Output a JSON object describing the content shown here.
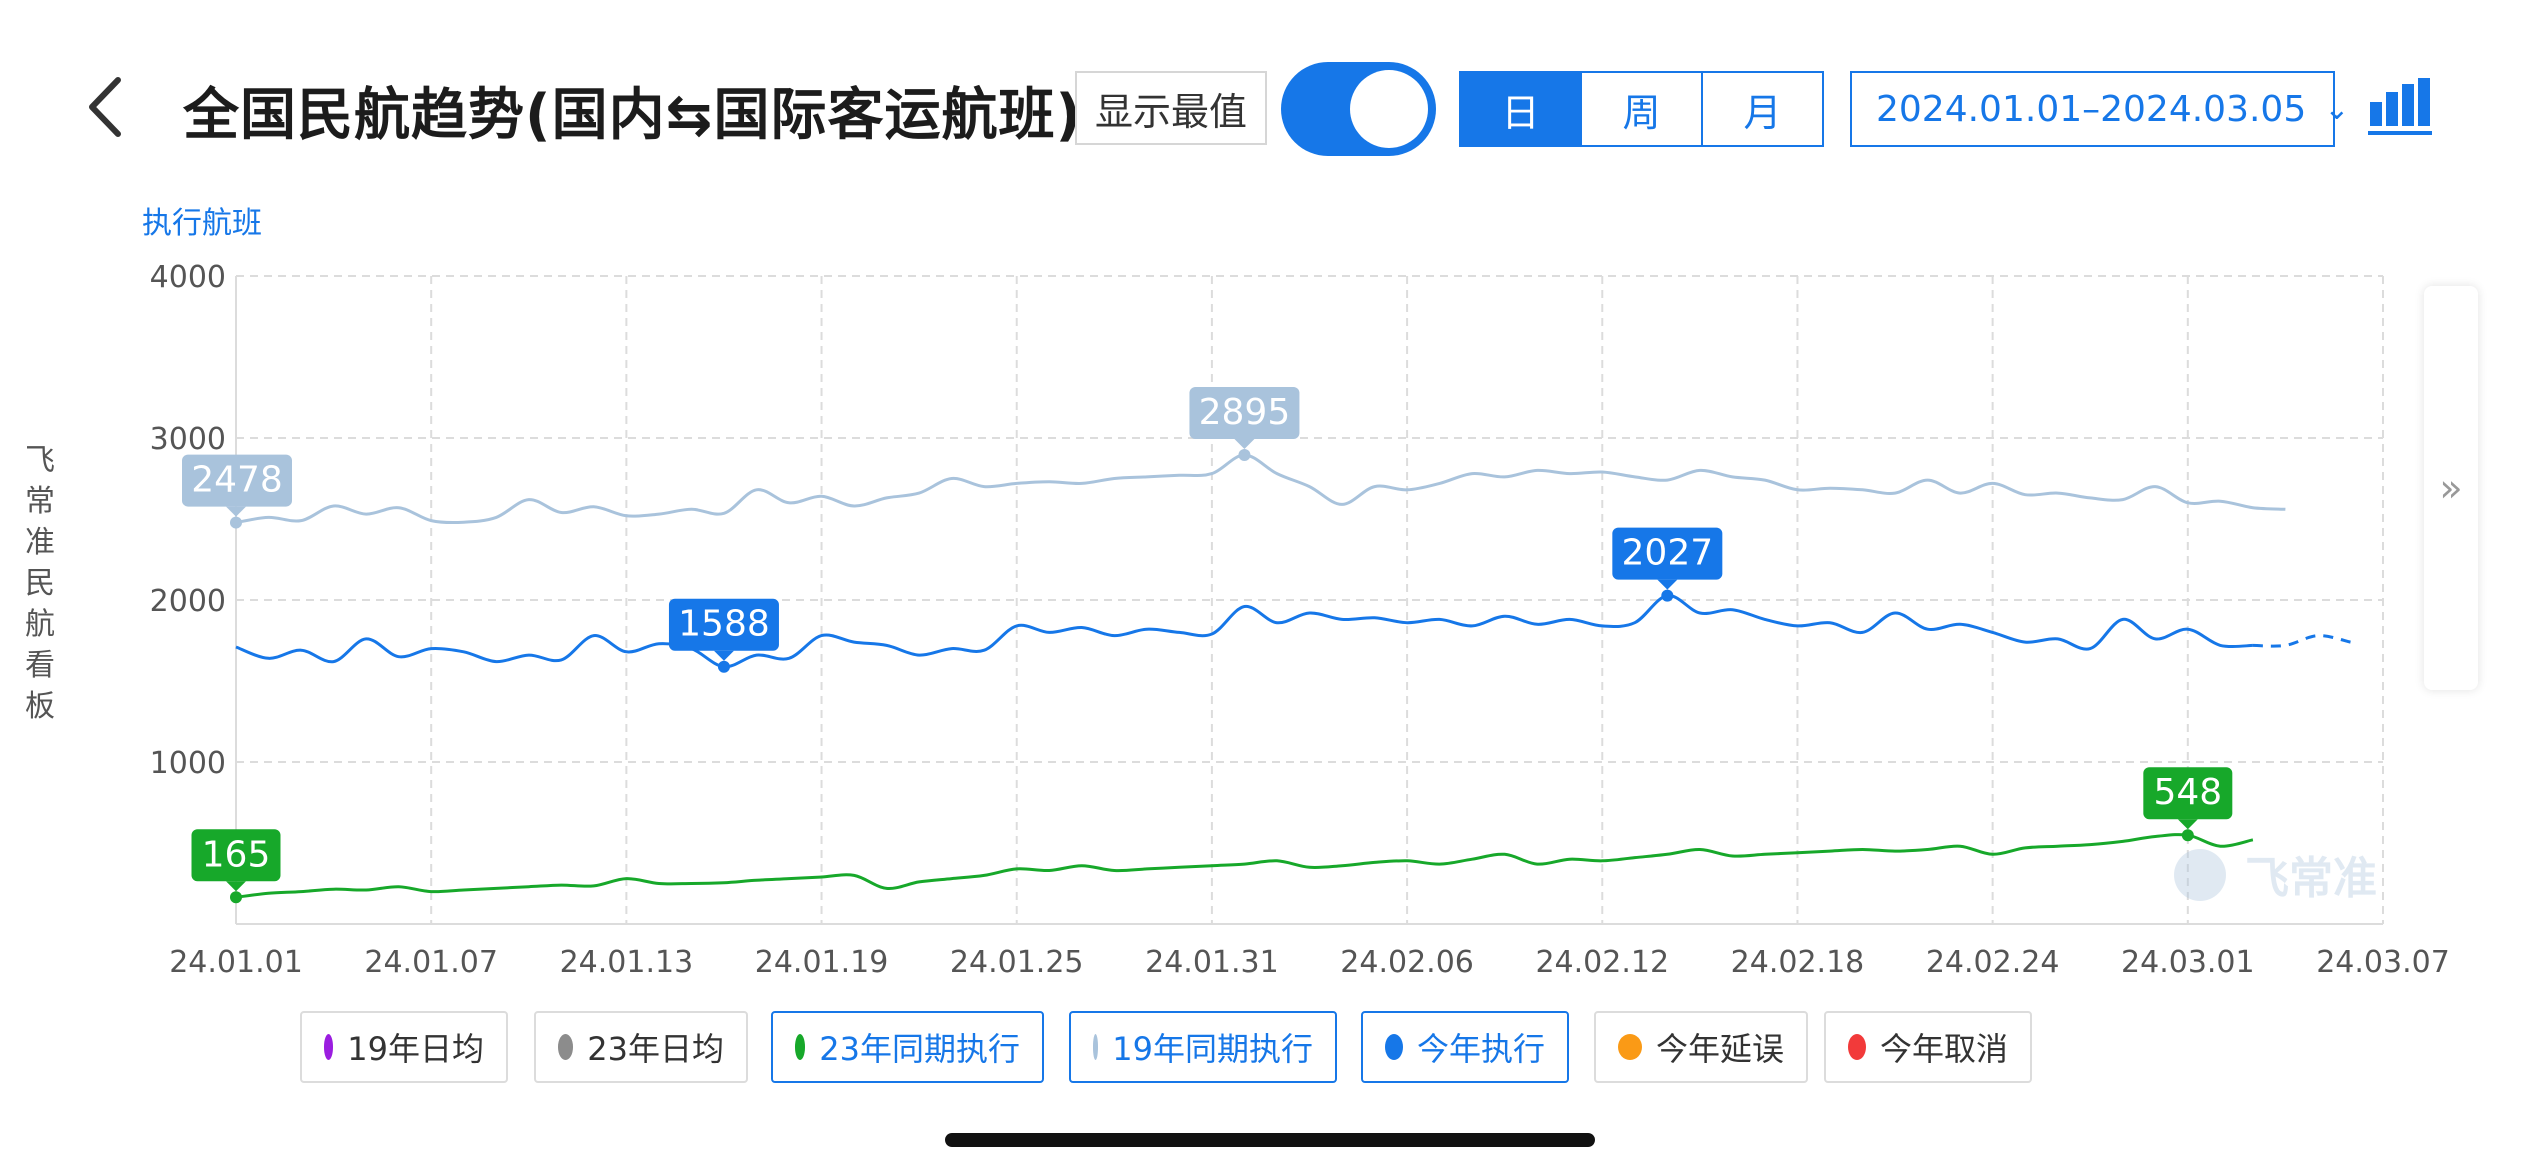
{
  "header": {
    "back_label": "<",
    "title": "全国民航趋势(国内⇆国际客运航班)",
    "show_extremes_label": "显示最值",
    "toggle_on": true,
    "segments": [
      "日",
      "周",
      "月"
    ],
    "active_segment": "日",
    "date_range": "2024.01.01–2024.03.05",
    "chart_icon": "bar-chart-icon"
  },
  "side": {
    "vertical_text": "飞常准民航看板",
    "expand_icon": "»"
  },
  "legend": [
    {
      "label": "19年日均",
      "color": "#9b1de0",
      "active": false
    },
    {
      "label": "23年日均",
      "color": "#8c8c8c",
      "active": false
    },
    {
      "label": "23年同期执行",
      "color": "#17a82a",
      "active": true
    },
    {
      "label": "19年同期执行",
      "color": "#a9c3dc",
      "active": true
    },
    {
      "label": "今年执行",
      "color": "#1677e8",
      "active": true
    },
    {
      "label": "今年延误",
      "color": "#fa9a16",
      "active": false
    },
    {
      "label": "今年取消",
      "color": "#f23a3a",
      "active": false
    }
  ],
  "watermark": "飞常准",
  "chart_data": {
    "type": "line",
    "ylabel": "执行航班",
    "ylim": [
      0,
      4000
    ],
    "yticks": [
      4000,
      3000,
      2000,
      1000
    ],
    "xticks": [
      "24.01.01",
      "24.01.07",
      "24.01.13",
      "24.01.19",
      "24.01.25",
      "24.01.31",
      "24.02.06",
      "24.02.12",
      "24.02.18",
      "24.02.24",
      "24.03.01",
      "24.03.07"
    ],
    "x_start": "2024-01-01",
    "x_end": "2024-03-07",
    "grid": true,
    "series": [
      {
        "name": "19年同期执行",
        "color": "#a9c3dc",
        "values": [
          2478,
          2510,
          2490,
          2580,
          2530,
          2570,
          2490,
          2480,
          2510,
          2620,
          2540,
          2575,
          2520,
          2530,
          2560,
          2535,
          2680,
          2600,
          2640,
          2580,
          2630,
          2660,
          2750,
          2700,
          2720,
          2730,
          2720,
          2750,
          2760,
          2770,
          2780,
          2895,
          2780,
          2700,
          2590,
          2700,
          2680,
          2720,
          2780,
          2760,
          2800,
          2780,
          2790,
          2760,
          2740,
          2800,
          2760,
          2740,
          2680,
          2690,
          2680,
          2660,
          2740,
          2660,
          2720,
          2650,
          2660,
          2630,
          2620,
          2700,
          2600,
          2610,
          2570,
          2560
        ],
        "min_label": 2478,
        "max_label": 2895
      },
      {
        "name": "今年执行",
        "color": "#1677e8",
        "values": [
          1710,
          1640,
          1690,
          1620,
          1760,
          1650,
          1700,
          1680,
          1620,
          1660,
          1630,
          1780,
          1680,
          1730,
          1700,
          1588,
          1660,
          1640,
          1780,
          1740,
          1720,
          1660,
          1700,
          1690,
          1840,
          1800,
          1830,
          1780,
          1820,
          1800,
          1790,
          1960,
          1860,
          1920,
          1880,
          1890,
          1860,
          1880,
          1840,
          1900,
          1850,
          1880,
          1840,
          1860,
          2027,
          1920,
          1940,
          1880,
          1840,
          1860,
          1800,
          1920,
          1820,
          1850,
          1800,
          1740,
          1760,
          1700,
          1880,
          1760,
          1820,
          1720,
          1720
        ],
        "forecast": [
          1720,
          1780,
          1740
        ],
        "min_label": 1588,
        "max_label": 2027
      },
      {
        "name": "23年同期执行",
        "color": "#17a82a",
        "values": [
          165,
          190,
          200,
          215,
          210,
          230,
          200,
          210,
          220,
          230,
          240,
          235,
          280,
          250,
          250,
          255,
          270,
          280,
          290,
          300,
          220,
          260,
          280,
          300,
          340,
          330,
          360,
          330,
          340,
          350,
          360,
          370,
          390,
          350,
          360,
          380,
          390,
          370,
          400,
          430,
          370,
          400,
          390,
          410,
          430,
          460,
          420,
          430,
          440,
          450,
          460,
          450,
          460,
          480,
          430,
          470,
          480,
          490,
          510,
          540,
          548,
          480,
          520
        ],
        "min_label": 165,
        "max_label": 548
      }
    ]
  }
}
